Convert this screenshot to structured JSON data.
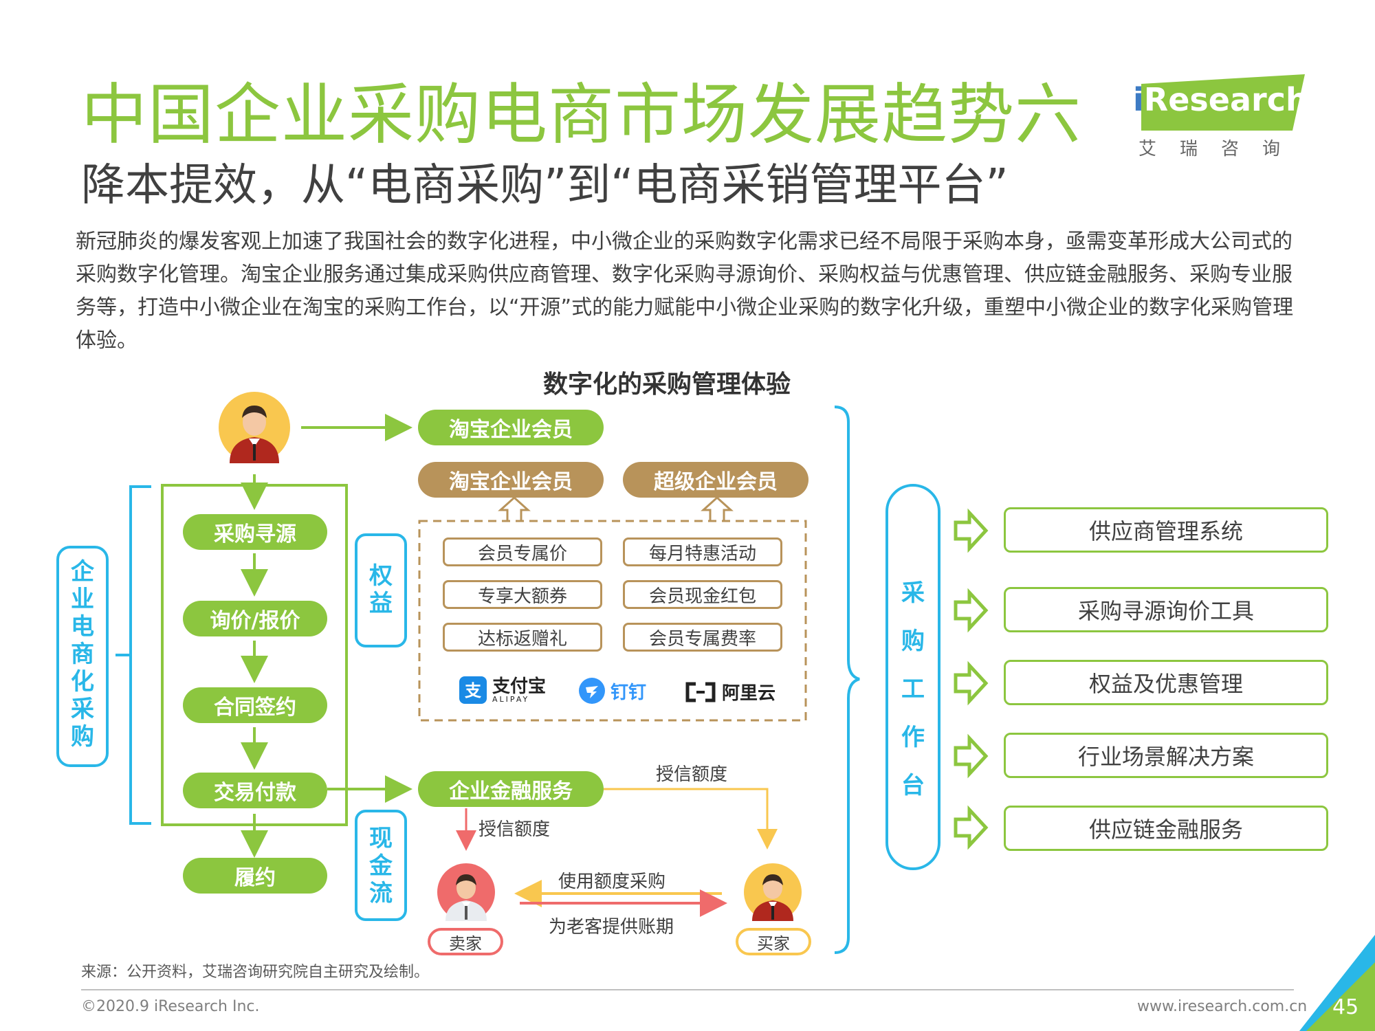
{
  "header": {
    "title": "中国企业采购电商市场发展趋势六",
    "subtitle": "降本提效，从“电商采购”到“电商采销管理平台”",
    "body": "新冠肺炎的爆发客观上加速了我国社会的数字化进程，中小微企业的采购数字化需求已经不局限于采购本身，亟需变革形成大公司式的采购数字化管理。淘宝企业服务通过集成采购供应商管理、数字化采购寻源询价、采购权益与优惠管理、供应链金融服务、采购专业服务等，打造中小微企业在淘宝的采购工作台，以“开源”式的能力赋能中小微企业采购的数字化升级，重塑中小微企业的数字化采购管理体验。"
  },
  "logo": {
    "i": "i",
    "brand": "Research",
    "cn": "艾瑞咨询"
  },
  "diagram": {
    "title": "数字化的采购管理体验",
    "left_bracket_label": "企业电商化采购",
    "member_top": "淘宝企业会员",
    "steps": [
      "采购寻源",
      "询价/报价",
      "合同签约",
      "交易付款",
      "履约"
    ],
    "benefits_label": "权益",
    "member_tiers": [
      "淘宝企业会员",
      "超级企业会员"
    ],
    "benefits": [
      "会员专属价",
      "每月特惠活动",
      "专享大额券",
      "会员现金红包",
      "达标返赠礼",
      "会员专属费率"
    ],
    "partners": [
      {
        "name": "支付宝",
        "sub": "ALIPAY",
        "color": "#1a8ae5"
      },
      {
        "name": "钉钉",
        "color": "#3296fa"
      },
      {
        "name": "阿里云",
        "color": "#222222"
      }
    ],
    "cashflow_label": "现金流",
    "finance": "企业金融服务",
    "credit_label_right": "授信额度",
    "credit_label_down": "授信额度",
    "use_credit": "使用额度采购",
    "provide_terms": "为老客提供账期",
    "seller": "卖家",
    "buyer": "买家",
    "workbench_label": "采购工作台",
    "systems": [
      "供应商管理系统",
      "采购寻源询价工具",
      "权益及优惠管理",
      "行业场景解决方案",
      "供应链金融服务"
    ]
  },
  "footer": {
    "source": "来源：公开资料，艾瑞咨询研究院自主研究及绘制。",
    "copyright": "©2020.9 iResearch Inc.",
    "website": "www.iresearch.com.cn",
    "page": "45"
  },
  "colors": {
    "green": "#8cc63f",
    "tan": "#b8935a",
    "blue": "#29b7e8",
    "red_arrow": "#ef6b6b",
    "yellow_arrow": "#f9c74f"
  }
}
